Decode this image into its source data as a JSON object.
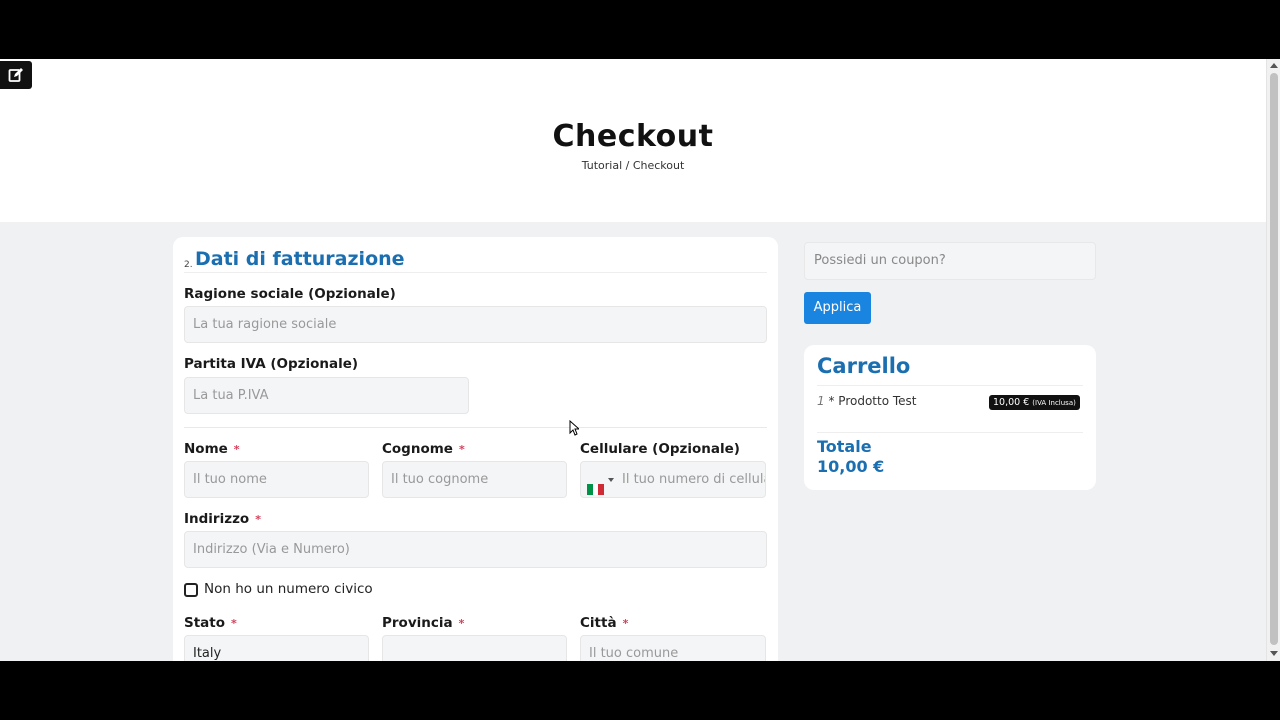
{
  "header": {
    "title": "Checkout",
    "breadcrumb": "Tutorial / Checkout",
    "edit_icon": "edit-icon"
  },
  "billing": {
    "step": "2.",
    "title": "Dati di fatturazione",
    "company": {
      "label": "Ragione sociale (Opzionale)",
      "placeholder": "La tua ragione sociale"
    },
    "vat": {
      "label": "Partita IVA (Opzionale)",
      "placeholder": "La tua P.IVA"
    },
    "name": {
      "label": "Nome",
      "required": "*",
      "placeholder": "Il tuo nome"
    },
    "surname": {
      "label": "Cognome",
      "required": "*",
      "placeholder": "Il tuo cognome"
    },
    "phone": {
      "label": "Cellulare (Opzionale)",
      "placeholder": "Il tuo numero di cellulare",
      "flag_icon": "italy-flag-icon"
    },
    "address": {
      "label": "Indirizzo",
      "required": "*",
      "placeholder": "Indirizzo (Via e Numero)"
    },
    "no_number": {
      "label": "Non ho un numero civico"
    },
    "country": {
      "label": "Stato",
      "required": "*",
      "value": "Italy"
    },
    "province": {
      "label": "Provincia",
      "required": "*",
      "value": ""
    },
    "city": {
      "label": "Città",
      "required": "*",
      "placeholder": "Il tuo comune"
    }
  },
  "coupon": {
    "placeholder": "Possiedi un coupon?",
    "apply_label": "Applica"
  },
  "cart": {
    "title": "Carrello",
    "items": [
      {
        "qty": "1",
        "sep": "*",
        "name": "Prodotto Test",
        "price": "10,00 €",
        "tax_note": "(IVA Inclusa)"
      }
    ],
    "total_label": "Totale",
    "total_value": "10,00 €"
  },
  "colors": {
    "accent": "#1b6fb0",
    "button": "#1a85e0",
    "required": "#d4405a"
  }
}
